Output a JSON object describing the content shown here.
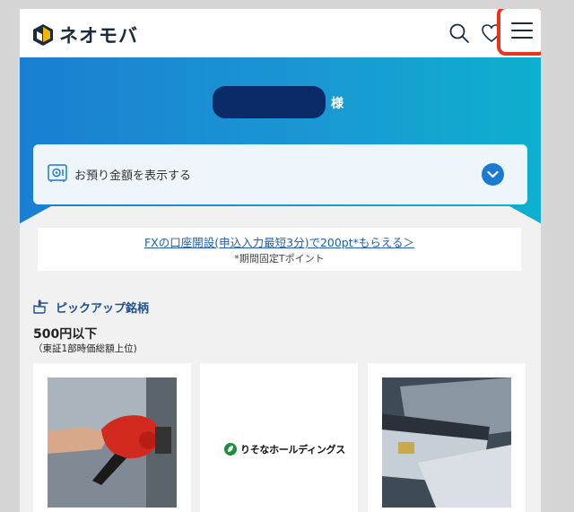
{
  "app": {
    "logo_text": "ネオモバ"
  },
  "header": {
    "icons": [
      "search-icon",
      "heart-icon",
      "hamburger-menu-icon"
    ]
  },
  "hero": {
    "honorific": "様"
  },
  "balance": {
    "label": "お預り金額を表示する",
    "icon": "safe-icon"
  },
  "promo": {
    "link_text": "FXの口座開設(申込入力最短3分)で200pt*もらえる＞",
    "note": "*期間固定Tポイント"
  },
  "pickup": {
    "title": "ピックアップ銘柄",
    "filter_title": "500円以下",
    "filter_sub": "（東証1部時価総額上位)",
    "cards": [
      {
        "image": "fuel-nozzle-photo"
      },
      {
        "logo_text": "りそなホールディングス"
      },
      {
        "image": "credit-cards-photo"
      }
    ]
  },
  "colors": {
    "accent": "#1a7bd0",
    "highlight_border": "#e8341c",
    "navy": "#0a2a68"
  }
}
